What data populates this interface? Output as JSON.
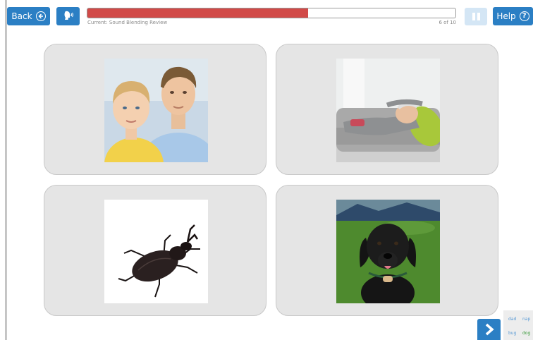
{
  "toolbar": {
    "back_label": "Back",
    "back_icon": "arrow-left-circle-icon",
    "audio_icon": "speaking-head-icon",
    "pause_icon": "pause-icon",
    "help_label": "Help",
    "help_glyph": "?",
    "help_icon": "question-circle-icon"
  },
  "progress": {
    "fraction": 0.6,
    "current_label": "Current: Sound Blending Review",
    "count_label": "6 of 10",
    "fill_color": "#d14a48"
  },
  "cards": [
    {
      "image": "father-and-son-photo"
    },
    {
      "image": "man-napping-on-couch-photo"
    },
    {
      "image": "beetle-bug-photo"
    },
    {
      "image": "black-dog-puppy-photo"
    }
  ],
  "next_icon": "chevron-right-icon",
  "word_list": [
    {
      "text": "dad",
      "color": "#5b9bd5"
    },
    {
      "text": "nap",
      "color": "#5b9bd5"
    },
    {
      "text": "bug",
      "color": "#5b9bd5"
    },
    {
      "text": "dog",
      "color": "#3a9a3a"
    }
  ],
  "colors": {
    "accent": "#2b7fc4",
    "card_bg": "#e5e5e5",
    "pause_bg": "#d4e6f5"
  }
}
